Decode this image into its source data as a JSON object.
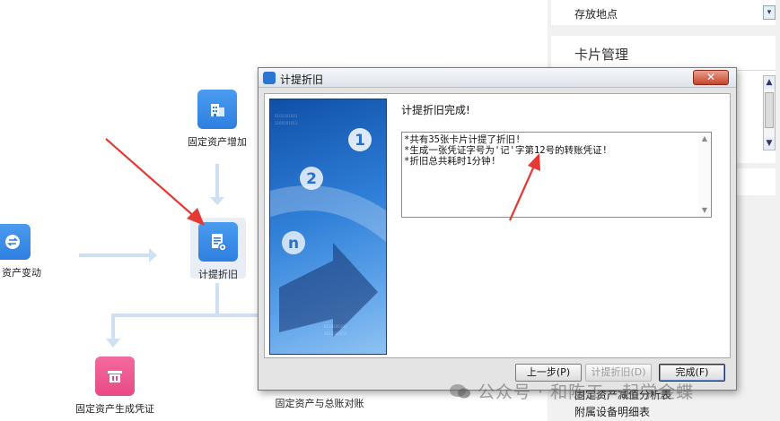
{
  "workflow": {
    "nodes": {
      "asset_add": {
        "label": "固定资产增加",
        "icon": "building-icon"
      },
      "asset_change": {
        "label": "资产变动",
        "icon": "swap-icon"
      },
      "depreciation": {
        "label": "计提折旧",
        "icon": "document-gear-icon"
      },
      "asset_voucher": {
        "label": "固定资产生成凭证",
        "icon": "register-icon"
      },
      "asset_reconcile": {
        "label": "固定资产与总账对账"
      }
    }
  },
  "right_panel": {
    "storage_location": "存放地点",
    "card_management": "卡片管理",
    "bottom_item_1": "固定资产减值分析表",
    "bottom_item_2": "附属设备明细表"
  },
  "dialog": {
    "title": "计提折旧",
    "close_glyph": "✕",
    "status_title": "计提折旧完成!",
    "log_lines": [
      "*共有35张卡片计提了折旧!",
      "*生成一张凭证字号为'记'字第12号的转账凭证!",
      "*折旧总共耗时1分钟!"
    ],
    "buttons": {
      "prev": "上一步(P)",
      "calc": "计提折旧(D)",
      "finish": "完成(F)"
    },
    "wizard_steps": [
      "1",
      "2",
      "n"
    ]
  },
  "watermark": {
    "text": "公众号 · 和陈工一起学金蝶"
  },
  "colors": {
    "annotation_red": "#e53935",
    "tile_blue": "#2f7fe0",
    "tile_pink": "#e84a84",
    "flow_line": "#cfe0f2"
  }
}
